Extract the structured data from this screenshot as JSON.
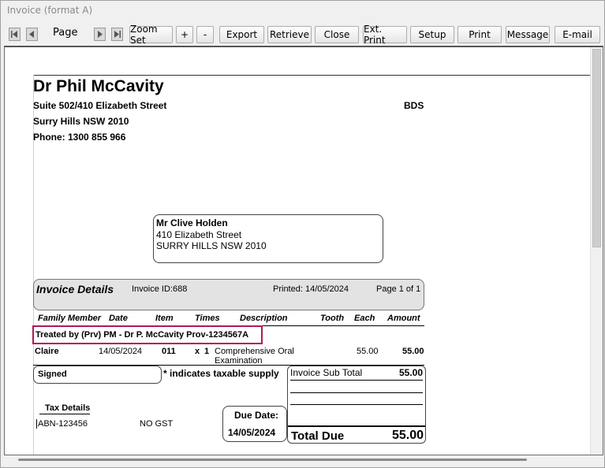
{
  "window": {
    "title": "Invoice (format A)"
  },
  "toolbar": {
    "page_label": "Page",
    "zoom_set": "Zoom Set",
    "zoom_in": "+",
    "zoom_out": "-",
    "export": "Export",
    "retrieve": "Retrieve",
    "close": "Close",
    "ext_print": "Ext. Print",
    "setup": "Setup",
    "print": "Print",
    "message": "Message",
    "email": "E-mail"
  },
  "practice": {
    "name": "Dr Phil McCavity",
    "address1": "Suite 502/410 Elizabeth Street",
    "address2": "Surry Hills NSW 2010",
    "phone": "Phone: 1300 855 966",
    "code": "BDS"
  },
  "recipient": {
    "name": "Mr Clive  Holden",
    "address1": "410 Elizabeth Street",
    "address2": "SURRY HILLS NSW 2010"
  },
  "invoice": {
    "title": "Invoice Details",
    "id": "Invoice ID:688",
    "printed": "Printed: 14/05/2024",
    "page": "Page 1 of 1"
  },
  "columns": [
    "Family Member",
    "Date",
    "Item",
    "Times",
    "Description",
    "Tooth",
    "Each",
    "Amount"
  ],
  "treated_by": "Treated by (Prv) PM - Dr P. McCavity Prov-1234567A",
  "line_item": {
    "member": "Claire",
    "date": "14/05/2024",
    "item": "011",
    "times_x": "x",
    "times": "1",
    "description_line1": "Comprehensive Oral",
    "description_line2": "Examination",
    "each": "55.00",
    "amount": "55.00"
  },
  "signed_label": "Signed",
  "taxable_note": "* indicates taxable supply",
  "totals": {
    "subtotal_label": "Invoice Sub Total",
    "subtotal_value": "55.00",
    "total_due_label": "Total Due",
    "total_due_value": "55.00"
  },
  "tax": {
    "title": "Tax Details",
    "abn": "ABN-123456",
    "gst": "NO GST"
  },
  "due": {
    "label": "Due Date:",
    "date": "14/05/2024"
  }
}
